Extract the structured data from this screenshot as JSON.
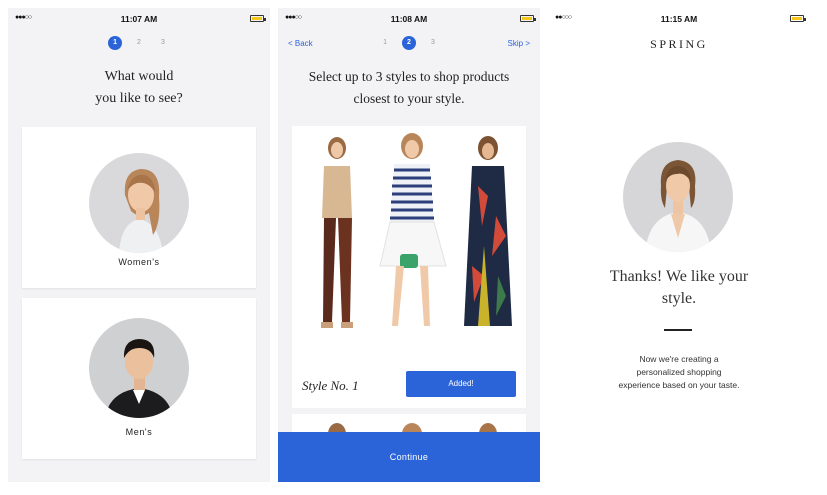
{
  "screen1": {
    "status": {
      "signal": "●●●○○",
      "time": "11:07 AM"
    },
    "steps": [
      "1",
      "2",
      "3"
    ],
    "active_step": 1,
    "heading_line1": "What would",
    "heading_line2": "you like to see?",
    "cards": [
      {
        "label": "Women's"
      },
      {
        "label": "Men's"
      }
    ]
  },
  "screen2": {
    "status": {
      "signal": "●●●○○",
      "time": "11:08 AM"
    },
    "back_label": "< Back",
    "skip_label": "Skip >",
    "steps": [
      "1",
      "2",
      "3"
    ],
    "active_step": 2,
    "heading_line1": "Select up to 3 styles to shop products",
    "heading_line2": "closest to your style.",
    "style_card": {
      "title": "Style No. 1",
      "button_label": "Added!"
    },
    "continue_label": "Continue"
  },
  "screen3": {
    "status": {
      "signal": "●●○○○",
      "time": "11:15 AM"
    },
    "brand": "SPRING",
    "thanks_line1": "Thanks! We like your",
    "thanks_line2": "style.",
    "message_line1": "Now we're creating a",
    "message_line2": "personalized shopping",
    "message_line3": "experience based on your taste."
  },
  "colors": {
    "accent": "#2b63d9",
    "battery": "#f5c518",
    "screen_bg": "#f3f3f5"
  }
}
